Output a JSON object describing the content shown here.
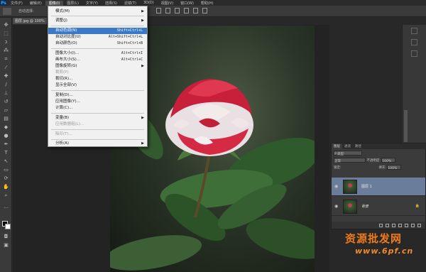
{
  "app": {
    "logo": "Ps",
    "menus": [
      "文件(F)",
      "编辑(E)",
      "图像(I)",
      "图层(L)",
      "文字(Y)",
      "选择(S)",
      "滤镜(T)",
      "3D(D)",
      "视图(V)",
      "窗口(W)",
      "帮助(H)"
    ],
    "active_menu_index": 2
  },
  "options_bar": {
    "auto_select_label": "自动选择:"
  },
  "document": {
    "tab_label": "图层.jpg @ 100%"
  },
  "image_menu": {
    "items": [
      {
        "label": "模式(M)",
        "shortcut": "",
        "submenu": true,
        "disabled": false,
        "selected": false
      },
      {
        "label": "调整(J)",
        "shortcut": "",
        "submenu": true,
        "disabled": false,
        "selected": false
      },
      {
        "label": "自动色调(N)",
        "shortcut": "Shift+Ctrl+L",
        "submenu": false,
        "disabled": false,
        "selected": true
      },
      {
        "label": "自动对比度(U)",
        "shortcut": "Alt+Shift+Ctrl+L",
        "submenu": false,
        "disabled": false,
        "selected": false
      },
      {
        "label": "自动颜色(O)",
        "shortcut": "Shift+Ctrl+B",
        "submenu": false,
        "disabled": false,
        "selected": false
      },
      {
        "label": "图像大小(I)...",
        "shortcut": "Alt+Ctrl+I",
        "submenu": false,
        "disabled": false,
        "selected": false
      },
      {
        "label": "画布大小(S)...",
        "shortcut": "Alt+Ctrl+C",
        "submenu": false,
        "disabled": false,
        "selected": false
      },
      {
        "label": "图像旋转(G)",
        "shortcut": "",
        "submenu": true,
        "disabled": false,
        "selected": false
      },
      {
        "label": "裁剪(P)",
        "shortcut": "",
        "submenu": false,
        "disabled": true,
        "selected": false
      },
      {
        "label": "裁切(R)...",
        "shortcut": "",
        "submenu": false,
        "disabled": false,
        "selected": false
      },
      {
        "label": "显示全部(V)",
        "shortcut": "",
        "submenu": false,
        "disabled": false,
        "selected": false
      },
      {
        "label": "复制(D)...",
        "shortcut": "",
        "submenu": false,
        "disabled": false,
        "selected": false
      },
      {
        "label": "应用图像(Y)...",
        "shortcut": "",
        "submenu": false,
        "disabled": false,
        "selected": false
      },
      {
        "label": "计算(C)...",
        "shortcut": "",
        "submenu": false,
        "disabled": false,
        "selected": false
      },
      {
        "label": "变量(B)",
        "shortcut": "",
        "submenu": true,
        "disabled": false,
        "selected": false
      },
      {
        "label": "应用数据组(L)...",
        "shortcut": "",
        "submenu": false,
        "disabled": true,
        "selected": false
      },
      {
        "label": "陷印(T)...",
        "shortcut": "",
        "submenu": false,
        "disabled": true,
        "selected": false
      },
      {
        "label": "分析(A)",
        "shortcut": "",
        "submenu": true,
        "disabled": false,
        "selected": false
      }
    ]
  },
  "layers_panel": {
    "tabs": [
      "图层",
      "通道",
      "路径"
    ],
    "kind_label": "P 类型",
    "blend_mode": "正常",
    "opacity_label": "不透明度:",
    "opacity_value": "100%",
    "lock_label": "锁定:",
    "fill_label": "填充:",
    "fill_value": "100%",
    "layers": [
      {
        "name": "图层 1",
        "selected": true,
        "locked": false
      },
      {
        "name": "背景",
        "selected": false,
        "locked": true
      }
    ]
  },
  "watermark": {
    "text": "资源批发网",
    "url": "www.6pf.cn"
  },
  "colors": {
    "menu_highlight": "#3a78c8",
    "watermark": "#f07a18"
  }
}
